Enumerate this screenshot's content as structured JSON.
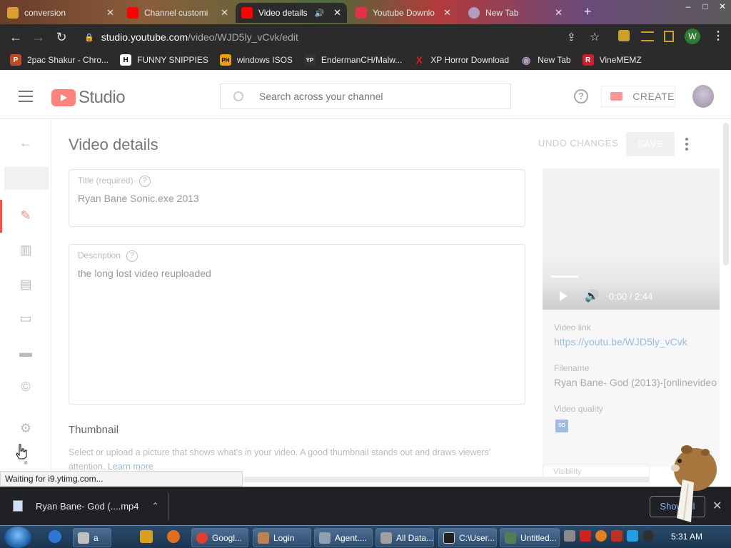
{
  "browser": {
    "tabs": [
      {
        "label": "conversion",
        "color": "#d9a030"
      },
      {
        "label": "Channel customi",
        "color": "#ff0000"
      },
      {
        "label": "Video details",
        "color": "#ff0000"
      },
      {
        "label": "Youtube Downlo",
        "color": "#e0304a"
      },
      {
        "label": "New Tab",
        "color": "#b0a0c0"
      }
    ],
    "window_controls": [
      "–",
      "□",
      "✕"
    ],
    "url_host": "studio.youtube.com",
    "url_path": "/video/WJD5ly_vCvk/edit",
    "profile_initial": "W",
    "bookmarks": [
      {
        "label": "2pac Shakur - Chro...",
        "icon": "P",
        "color": "#c04a20"
      },
      {
        "label": "FUNNY SNIPPIES",
        "icon": "H",
        "color": "#ffffff"
      },
      {
        "label": "windows ISOS",
        "icon": "PH",
        "color": "#f0a000"
      },
      {
        "label": "EndermanCH/Malw...",
        "icon": "YP",
        "color": "#333333"
      },
      {
        "label": "XP Horror Download",
        "icon": "X",
        "color": "#e02020"
      },
      {
        "label": "New Tab",
        "icon": "◉",
        "color": "#9080a0"
      },
      {
        "label": "VineMEMZ",
        "icon": "R",
        "color": "#d02030"
      }
    ]
  },
  "header": {
    "logo_text": "Studio",
    "search_placeholder": "Search across your channel",
    "create_label": "CREATE"
  },
  "main": {
    "title": "Video details",
    "undo_label": "UNDO CHANGES",
    "save_label": "SAVE",
    "title_field": {
      "label": "Title (required)",
      "value": "Ryan Bane  Sonic.exe 2013"
    },
    "description_field": {
      "label": "Description",
      "value": "the long lost video reuploaded"
    },
    "thumbnail": {
      "heading": "Thumbnail",
      "desc": "Select or upload a picture that shows what's in your video. A good thumbnail stands out and draws viewers'",
      "desc2": "attention.",
      "learn_more": "Learn more"
    }
  },
  "side": {
    "player_time": "0:00 / 2:44",
    "video_link_label": "Video link",
    "video_link": "https://youtu.be/WJD5ly_vCvk",
    "filename_label": "Filename",
    "filename": "Ryan Bane- God (2013)-[onlinevideo",
    "quality_label": "Video quality",
    "quality_badge": "SD",
    "partial_label": "Visibility"
  },
  "status_text": "Waiting for i9.ytimg.com...",
  "download": {
    "filename": "Ryan Bane- God (....mp4",
    "show_all": "Show all"
  },
  "taskbar": {
    "items": [
      {
        "label": "a",
        "color": "#c0c0c0"
      },
      {
        "label": "Googl...",
        "color": "#e04030"
      },
      {
        "label": "Login",
        "color": "#c08050"
      },
      {
        "label": "Agent....",
        "color": "#90a0b0"
      },
      {
        "label": "All Data...",
        "color": "#a0a0a0"
      },
      {
        "label": "C:\\User...",
        "color": "#202020"
      },
      {
        "label": "Untitled...",
        "color": "#508050"
      }
    ],
    "clock": "5:31 AM"
  },
  "colors": {
    "accent": "#ff4e45",
    "link": "#9bbbe0",
    "chrome_dark": "#2b2b2b"
  }
}
